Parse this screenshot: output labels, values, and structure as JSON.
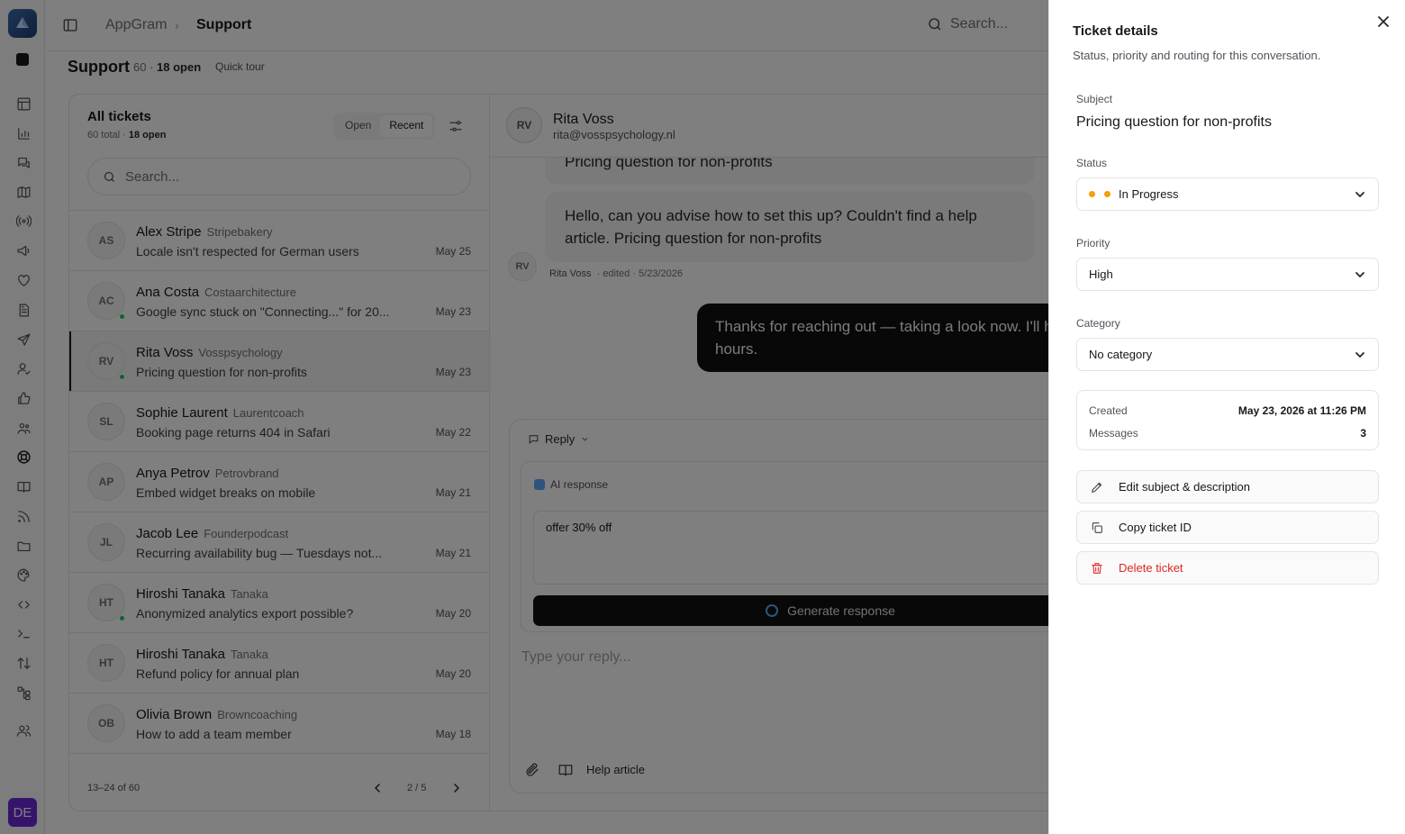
{
  "app": {
    "breadcrumb": [
      "AppGram",
      "Support"
    ],
    "search_placeholder": "Search...",
    "user_initials": "DE"
  },
  "page": {
    "title": "Support",
    "total": "60",
    "open_label": "18 open",
    "quick_tour": "Quick tour"
  },
  "ticket_list": {
    "title": "All tickets",
    "summary_total": "60 total ·",
    "summary_open": "18 open",
    "filters": [
      "Open",
      "Recent"
    ],
    "active_filter": "Recent",
    "search_placeholder": "Search...",
    "tickets": [
      {
        "initials": "AS",
        "name": "Alex Stripe",
        "company": "Stripebakery",
        "subject": "Locale isn't respected for German users",
        "date": "May 25",
        "online": false,
        "selected": false
      },
      {
        "initials": "AC",
        "name": "Ana Costa",
        "company": "Costaarchitecture",
        "subject": "Google sync stuck on \"Connecting...\" for 20...",
        "date": "May 23",
        "online": true,
        "selected": false
      },
      {
        "initials": "RV",
        "name": "Rita Voss",
        "company": "Vosspsychology",
        "subject": "Pricing question for non-profits",
        "date": "May 23",
        "online": true,
        "selected": true
      },
      {
        "initials": "SL",
        "name": "Sophie Laurent",
        "company": "Laurentcoach",
        "subject": "Booking page returns 404 in Safari",
        "date": "May 22",
        "online": false,
        "selected": false
      },
      {
        "initials": "AP",
        "name": "Anya Petrov",
        "company": "Petrovbrand",
        "subject": "Embed widget breaks on mobile",
        "date": "May 21",
        "online": false,
        "selected": false
      },
      {
        "initials": "JL",
        "name": "Jacob Lee",
        "company": "Founderpodcast",
        "subject": "Recurring availability bug — Tuesdays not...",
        "date": "May 21",
        "online": false,
        "selected": false
      },
      {
        "initials": "HT",
        "name": "Hiroshi Tanaka",
        "company": "Tanaka",
        "subject": "Anonymized analytics export possible?",
        "date": "May 20",
        "online": true,
        "selected": false
      },
      {
        "initials": "HT",
        "name": "Hiroshi Tanaka",
        "company": "Tanaka",
        "subject": "Refund policy for annual plan",
        "date": "May 20",
        "online": false,
        "selected": false
      },
      {
        "initials": "OB",
        "name": "Olivia Brown",
        "company": "Browncoaching",
        "subject": "How to add a team member",
        "date": "May 18",
        "online": false,
        "selected": false
      }
    ],
    "range": "13–24 of 60",
    "page_indicator": "2 / 5"
  },
  "conversation": {
    "contact": {
      "initials": "RV",
      "name": "Rita Voss",
      "email": "rita@vosspsychology.nl"
    },
    "msg1_tail": "Pricing question for non-profits",
    "msg2": "Hello, can you advise how to set this up? Couldn't find a help article. Pricing question for non-profits",
    "msg_author": "Rita Voss",
    "msg_edited": "· edited · 5/23/2026",
    "reply": "Thanks for reaching out — taking a look now. I'll ho... hours.",
    "reply_line1": "Thanks for reaching out — taking a look now. I'll ho",
    "reply_line2": "hours.",
    "composer": {
      "mode": "Reply",
      "ai_label": "AI response",
      "ai_prompt": "offer 30% off",
      "generate_label": "Generate response",
      "reply_placeholder": "Type your reply...",
      "help_article": "Help article"
    }
  },
  "drawer": {
    "title": "Ticket details",
    "subtitle": "Status, priority and routing for this conversation.",
    "subject_label": "Subject",
    "subject": "Pricing question for non-profits",
    "status_label": "Status",
    "status": "In Progress",
    "status_color": "#f59e0b",
    "priority_label": "Priority",
    "priority": "High",
    "category_label": "Category",
    "category": "No category",
    "created_label": "Created",
    "created": "May 23, 2026 at 11:26 PM",
    "messages_label": "Messages",
    "messages": "3",
    "actions": {
      "edit": "Edit subject & description",
      "copy": "Copy ticket ID",
      "delete": "Delete ticket"
    }
  }
}
